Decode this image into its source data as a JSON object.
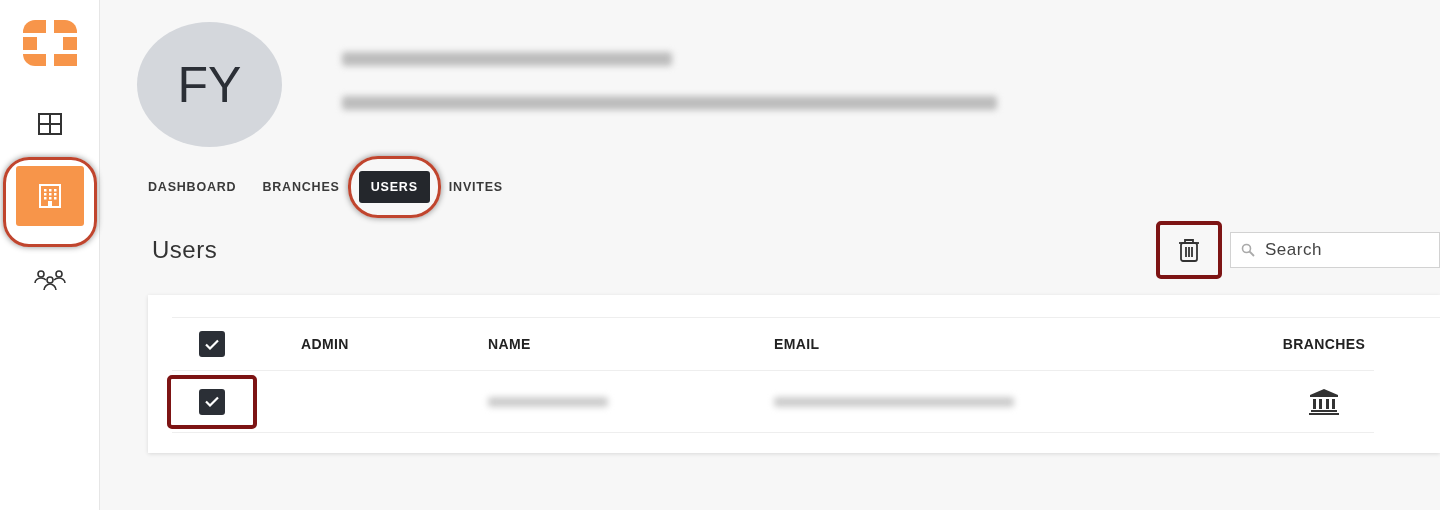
{
  "sidebar": {
    "items": [
      {
        "kind": "grid",
        "selected": false,
        "annotated": false
      },
      {
        "kind": "building",
        "selected": true,
        "annotated": true
      },
      {
        "kind": "people",
        "selected": false,
        "annotated": false
      }
    ]
  },
  "organization": {
    "initials": "FY"
  },
  "tabs": [
    {
      "label": "DASHBOARD",
      "selected": false,
      "annotated": false
    },
    {
      "label": "BRANCHES",
      "selected": false,
      "annotated": false
    },
    {
      "label": "USERS",
      "selected": true,
      "annotated": true
    },
    {
      "label": "INVITES",
      "selected": false,
      "annotated": false
    }
  ],
  "section_title": "Users",
  "toolbar": {
    "delete_annotated": true,
    "search": {
      "placeholder": "Search"
    }
  },
  "table": {
    "header_checked": true,
    "columns": [
      "ADMIN",
      "NAME",
      "EMAIL",
      "BRANCHES"
    ],
    "rows": [
      {
        "checked": true,
        "annotated": true
      }
    ]
  }
}
